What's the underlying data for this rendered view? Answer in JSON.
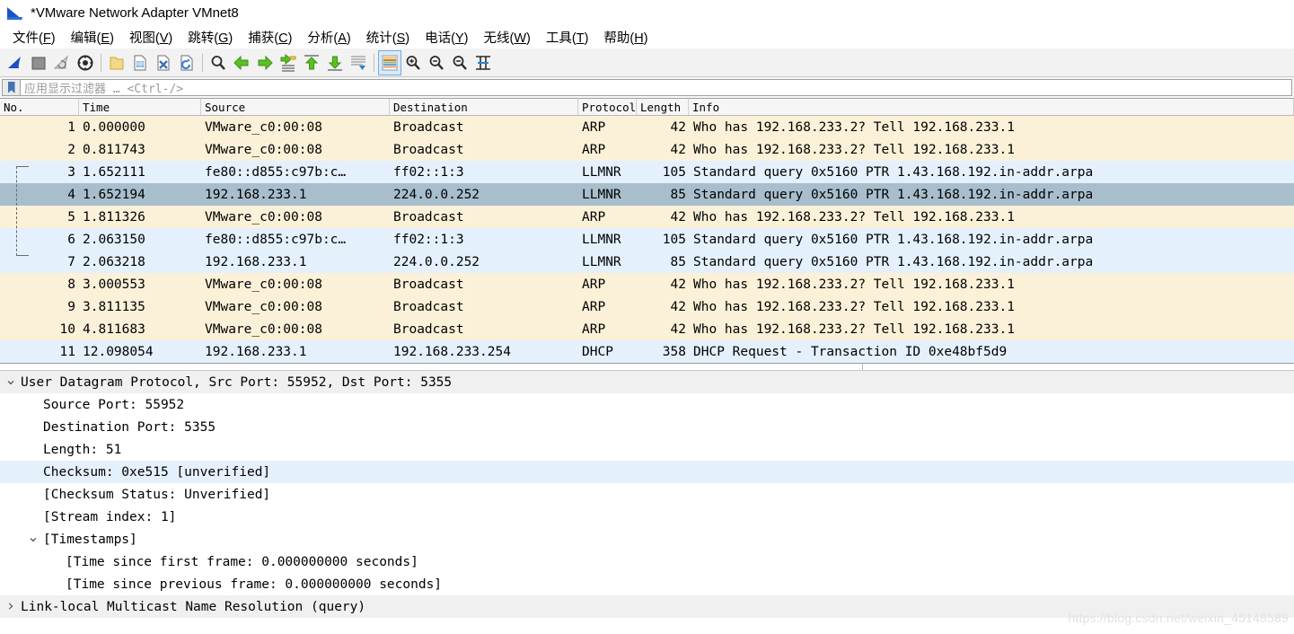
{
  "window": {
    "title": "*VMware Network Adapter VMnet8",
    "app_icon": "wireshark-fin-icon"
  },
  "menubar": [
    {
      "label": "文件",
      "mnemonic": "F"
    },
    {
      "label": "编辑",
      "mnemonic": "E"
    },
    {
      "label": "视图",
      "mnemonic": "V"
    },
    {
      "label": "跳转",
      "mnemonic": "G"
    },
    {
      "label": "捕获",
      "mnemonic": "C"
    },
    {
      "label": "分析",
      "mnemonic": "A"
    },
    {
      "label": "统计",
      "mnemonic": "S"
    },
    {
      "label": "电话",
      "mnemonic": "Y"
    },
    {
      "label": "无线",
      "mnemonic": "W"
    },
    {
      "label": "工具",
      "mnemonic": "T"
    },
    {
      "label": "帮助",
      "mnemonic": "H"
    }
  ],
  "toolbar": {
    "buttons": [
      {
        "name": "start-capture-icon",
        "glyph": "fin-blue"
      },
      {
        "name": "stop-capture-icon",
        "glyph": "square-gray"
      },
      {
        "name": "restart-capture-icon",
        "glyph": "fin-gray-arrow"
      },
      {
        "name": "capture-options-icon",
        "glyph": "gear-circle"
      },
      {
        "sep": true
      },
      {
        "name": "open-file-icon",
        "glyph": "folder-yellow"
      },
      {
        "name": "save-file-icon",
        "glyph": "page-save"
      },
      {
        "name": "close-file-icon",
        "glyph": "page-close"
      },
      {
        "name": "reload-file-icon",
        "glyph": "page-reload"
      },
      {
        "sep": true
      },
      {
        "name": "find-packet-icon",
        "glyph": "magnifier"
      },
      {
        "name": "go-back-icon",
        "glyph": "arrow-left-green"
      },
      {
        "name": "go-forward-icon",
        "glyph": "arrow-right-green"
      },
      {
        "name": "go-to-packet-icon",
        "glyph": "goto-packet"
      },
      {
        "name": "go-to-first-icon",
        "glyph": "arrow-up-green"
      },
      {
        "name": "go-to-last-icon",
        "glyph": "arrow-down-green"
      },
      {
        "name": "auto-scroll-icon",
        "glyph": "autoscroll"
      },
      {
        "sep": true
      },
      {
        "name": "colorize-packets-icon",
        "glyph": "colorize",
        "active": true
      },
      {
        "name": "zoom-in-icon",
        "glyph": "zoom-in"
      },
      {
        "name": "zoom-out-icon",
        "glyph": "zoom-out"
      },
      {
        "name": "zoom-reset-icon",
        "glyph": "zoom-reset"
      },
      {
        "name": "resize-columns-icon",
        "glyph": "resize-columns"
      }
    ]
  },
  "filter": {
    "placeholder": "应用显示过滤器 … <Ctrl-/>",
    "value": ""
  },
  "packet_list": {
    "columns": [
      "No.",
      "Time",
      "Source",
      "Destination",
      "Protocol",
      "Length",
      "Info"
    ],
    "rows": [
      {
        "no": "1",
        "time": "0.000000",
        "src": "VMware_c0:00:08",
        "dst": "Broadcast",
        "proto": "ARP",
        "len": "42",
        "info": "Who has 192.168.233.2? Tell 192.168.233.1",
        "style": "arp"
      },
      {
        "no": "2",
        "time": "0.811743",
        "src": "VMware_c0:00:08",
        "dst": "Broadcast",
        "proto": "ARP",
        "len": "42",
        "info": "Who has 192.168.233.2? Tell 192.168.233.1",
        "style": "arp"
      },
      {
        "no": "3",
        "time": "1.652111",
        "src": "fe80::d855:c97b:c…",
        "dst": "ff02::1:3",
        "proto": "LLMNR",
        "len": "105",
        "info": "Standard query 0x5160 PTR 1.43.168.192.in-addr.arpa",
        "style": "blue"
      },
      {
        "no": "4",
        "time": "1.652194",
        "src": "192.168.233.1",
        "dst": "224.0.0.252",
        "proto": "LLMNR",
        "len": "85",
        "info": "Standard query 0x5160 PTR 1.43.168.192.in-addr.arpa",
        "style": "sel"
      },
      {
        "no": "5",
        "time": "1.811326",
        "src": "VMware_c0:00:08",
        "dst": "Broadcast",
        "proto": "ARP",
        "len": "42",
        "info": "Who has 192.168.233.2? Tell 192.168.233.1",
        "style": "arp"
      },
      {
        "no": "6",
        "time": "2.063150",
        "src": "fe80::d855:c97b:c…",
        "dst": "ff02::1:3",
        "proto": "LLMNR",
        "len": "105",
        "info": "Standard query 0x5160 PTR 1.43.168.192.in-addr.arpa",
        "style": "blue"
      },
      {
        "no": "7",
        "time": "2.063218",
        "src": "192.168.233.1",
        "dst": "224.0.0.252",
        "proto": "LLMNR",
        "len": "85",
        "info": "Standard query 0x5160 PTR 1.43.168.192.in-addr.arpa",
        "style": "blue"
      },
      {
        "no": "8",
        "time": "3.000553",
        "src": "VMware_c0:00:08",
        "dst": "Broadcast",
        "proto": "ARP",
        "len": "42",
        "info": "Who has 192.168.233.2? Tell 192.168.233.1",
        "style": "arp"
      },
      {
        "no": "9",
        "time": "3.811135",
        "src": "VMware_c0:00:08",
        "dst": "Broadcast",
        "proto": "ARP",
        "len": "42",
        "info": "Who has 192.168.233.2? Tell 192.168.233.1",
        "style": "arp"
      },
      {
        "no": "10",
        "time": "4.811683",
        "src": "VMware_c0:00:08",
        "dst": "Broadcast",
        "proto": "ARP",
        "len": "42",
        "info": "Who has 192.168.233.2? Tell 192.168.233.1",
        "style": "arp"
      },
      {
        "no": "11",
        "time": "12.098054",
        "src": "192.168.233.1",
        "dst": "192.168.233.254",
        "proto": "DHCP",
        "len": "358",
        "info": "DHCP Request  - Transaction ID 0xe48bf5d9",
        "style": "blue"
      }
    ]
  },
  "detail_pane": {
    "rows": [
      {
        "label": "User Datagram Protocol, Src Port: 55952, Dst Port: 5355",
        "indent": 0,
        "twisty": "expanded",
        "style": "hdrbg"
      },
      {
        "label": "Source Port: 55952",
        "indent": 1,
        "twisty": "none",
        "style": "plain"
      },
      {
        "label": "Destination Port: 5355",
        "indent": 1,
        "twisty": "none",
        "style": "plain"
      },
      {
        "label": "Length: 51",
        "indent": 1,
        "twisty": "none",
        "style": "plain"
      },
      {
        "label": "Checksum: 0xe515 [unverified]",
        "indent": 1,
        "twisty": "none",
        "style": "hl"
      },
      {
        "label": "[Checksum Status: Unverified]",
        "indent": 1,
        "twisty": "none",
        "style": "plain"
      },
      {
        "label": "[Stream index: 1]",
        "indent": 1,
        "twisty": "none",
        "style": "plain"
      },
      {
        "label": "[Timestamps]",
        "indent": 1,
        "twisty": "expanded",
        "style": "plain"
      },
      {
        "label": "[Time since first frame: 0.000000000 seconds]",
        "indent": 2,
        "twisty": "none",
        "style": "plain"
      },
      {
        "label": "[Time since previous frame: 0.000000000 seconds]",
        "indent": 2,
        "twisty": "none",
        "style": "plain"
      },
      {
        "label": "Link-local Multicast Name Resolution (query)",
        "indent": 0,
        "twisty": "collapsed",
        "style": "hdrbg"
      }
    ]
  },
  "watermark": "https://blog.csdn.net/weixin_45148589",
  "colors": {
    "arp_row": "#fbf1d8",
    "protocol_row": "#e4f0fb",
    "selected_row": "#a8becd",
    "accent_blue": "#1a55c8",
    "toolbar_bg": "#f2f2f2"
  }
}
